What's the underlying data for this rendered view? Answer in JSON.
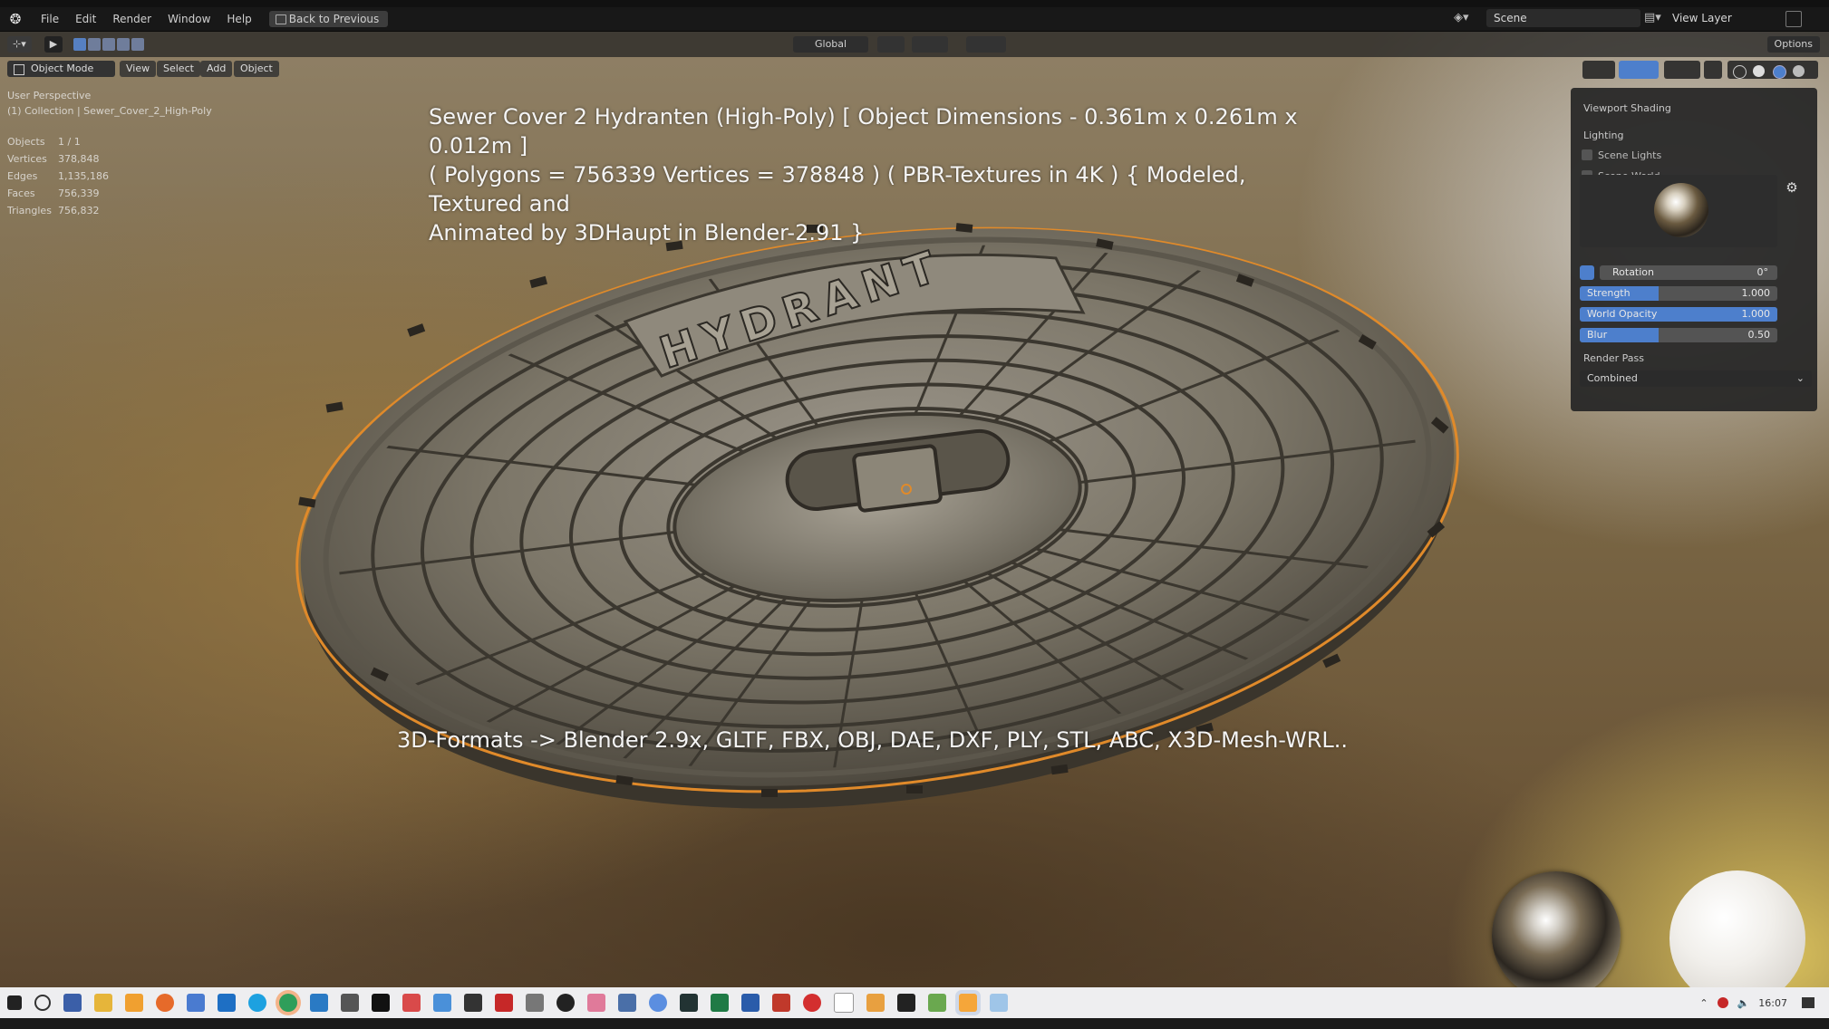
{
  "topbar": {
    "menus": [
      "File",
      "Edit",
      "Render",
      "Window",
      "Help"
    ],
    "back_button": "Back to Previous",
    "scene": "Scene",
    "view_layer": "View Layer"
  },
  "viewport_header": {
    "transform_orientation": "Global",
    "options": "Options",
    "mode": "Object Mode",
    "menus": [
      "View",
      "Select",
      "Add",
      "Object"
    ]
  },
  "overlay": {
    "perspective": "User Perspective",
    "collection": "(1) Collection | Sewer_Cover_2_High-Poly",
    "stats": [
      {
        "label": "Objects",
        "value": "1 / 1"
      },
      {
        "label": "Vertices",
        "value": "378,848"
      },
      {
        "label": "Edges",
        "value": "1,135,186"
      },
      {
        "label": "Faces",
        "value": "756,339"
      },
      {
        "label": "Triangles",
        "value": "756,832"
      }
    ]
  },
  "title_lines": [
    "Sewer Cover 2 Hydranten (High-Poly) [ Object Dimensions -  0.361m x 0.261m x 0.012m ]",
    "( Polygons = 756339 Vertices = 378848 ) ( PBR-Textures in 4K ) { Modeled, Textured and",
    "Animated by 3DHaupt in Blender-2.91 }"
  ],
  "cover_text": "HYDRANT",
  "formats_line": "3D-Formats -> Blender 2.9x, GLTF, FBX, OBJ, DAE, DXF, PLY, STL, ABC, X3D-Mesh-WRL..",
  "shading_panel": {
    "title": "Viewport Shading",
    "lighting": "Lighting",
    "scene_lights": "Scene Lights",
    "scene_world": "Scene World",
    "rotation_label": "Rotation",
    "rotation_value": "0°",
    "sliders": [
      {
        "label": "Strength",
        "value": "1.000",
        "fraction": 0.4
      },
      {
        "label": "World Opacity",
        "value": "1.000",
        "fraction": 1.0
      },
      {
        "label": "Blur",
        "value": "0.50",
        "fraction": 0.4
      }
    ],
    "render_pass_label": "Render Pass",
    "render_pass_value": "Combined"
  },
  "taskbar": {
    "clock": "16:07"
  },
  "colors": {
    "selection_outline": "#e08a2a",
    "accent_blue": "#4d7fcc"
  }
}
